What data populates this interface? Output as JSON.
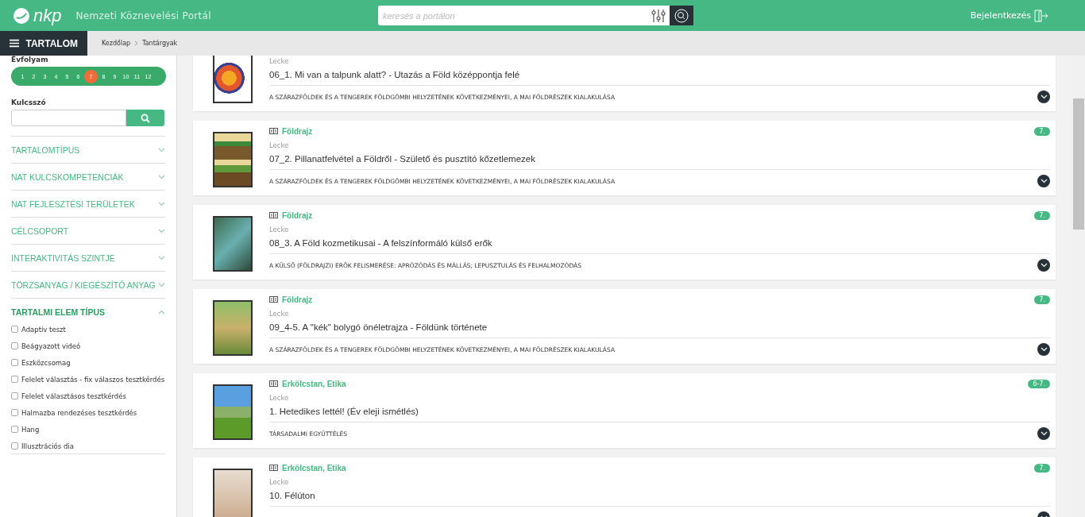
{
  "header": {
    "logo_text": "nkp",
    "portal_name": "Nemzeti Köznevelési Portál",
    "search": {
      "placeholder": "keresés a portálon"
    },
    "login": "Bejelentkezés"
  },
  "subbar": {
    "menu_button": "TARTALOM",
    "breadcrumbs": [
      {
        "label": "Kezdőlap"
      },
      {
        "label": "Tantárgyak"
      }
    ]
  },
  "sidebar": {
    "grade_label": "Évfolyam",
    "grades": [
      {
        "label": "1",
        "selected": false
      },
      {
        "label": "2",
        "selected": false
      },
      {
        "label": "3",
        "selected": false
      },
      {
        "label": "4",
        "selected": false
      },
      {
        "label": "5",
        "selected": false
      },
      {
        "label": "6",
        "selected": false
      },
      {
        "label": "7",
        "selected": true
      },
      {
        "label": "8",
        "selected": false
      },
      {
        "label": "9",
        "selected": false
      },
      {
        "label": "10",
        "selected": false
      },
      {
        "label": "11",
        "selected": false
      },
      {
        "label": "12",
        "selected": false
      }
    ],
    "keyword_label": "Kulcsszó",
    "filters": [
      {
        "label": "TARTALOMTÍPUS",
        "expanded": false
      },
      {
        "label": "NAT KULCSKOMPETENCIÁK",
        "expanded": false
      },
      {
        "label": "NAT FEJLESZTÉSI TERÜLETEK",
        "expanded": false
      },
      {
        "label": "CÉLCSOPORT",
        "expanded": false
      },
      {
        "label": "INTERAKTIVITÁS SZINTJE",
        "expanded": false
      },
      {
        "label": "TÖRZSANYAG / KIEGÉSZÍTŐ ANYAG",
        "expanded": false
      },
      {
        "label": "TARTALMI ELEM TÍPUS",
        "expanded": true,
        "options": [
          {
            "label": "Adaptív teszt",
            "checked": false
          },
          {
            "label": "Beágyazott videó",
            "checked": false
          },
          {
            "label": "Eszközcsomag",
            "checked": false
          },
          {
            "label": "Felelet választás - fix válaszos tesztkérdés",
            "checked": false
          },
          {
            "label": "Felelet választásos tesztkérdés",
            "checked": false
          },
          {
            "label": "Halmazba rendezéses tesztkérdés",
            "checked": false
          },
          {
            "label": "Hang",
            "checked": false
          },
          {
            "label": "Illusztrációs dia",
            "checked": false
          }
        ]
      }
    ]
  },
  "results": [
    {
      "type": "Lecke",
      "title": "06_1. Mi van a talpunk alatt? - Utazás a Föld középpontja felé",
      "topic": "A SZÁRAZFÖLDEK ÉS A TENGEREK FÖLDGÖMBI HELYZETÉNEK KÖVETKEZMÉNYEI, A MAI FÖLDRÉSZEK KIALAKULÁSA"
    },
    {
      "subject": "Földrajz",
      "grade": "7.",
      "type": "Lecke",
      "title": "07_2. Pillanatfelvétel a Földről - Születő és pusztító kőzetlemezek",
      "topic": "A SZÁRAZFÖLDEK ÉS A TENGEREK FÖLDGÖMBI HELYZETÉNEK KÖVETKEZMÉNYEI, A MAI FÖLDRÉSZEK KIALAKULÁSA"
    },
    {
      "subject": "Földrajz",
      "grade": "7.",
      "type": "Lecke",
      "title": "08_3. A Föld kozmetikusai - A felszínformáló külső erők",
      "topic": "A KÜLSŐ (FÖLDRAJZI) ERŐK FELISMERÉSE: APRÓZÓDÁS ÉS MÁLLÁS; LEPUSZTULÁS ÉS FELHALMOZÓDÁS"
    },
    {
      "subject": "Földrajz",
      "grade": "7.",
      "type": "Lecke",
      "title": "09_4-5. A \"kék\" bolygó önéletrajza - Földünk története",
      "topic": "A SZÁRAZFÖLDEK ÉS A TENGEREK FÖLDGÖMBI HELYZETÉNEK KÖVETKEZMÉNYEI, A MAI FÖLDRÉSZEK KIALAKULÁSA"
    },
    {
      "subject": "Erkölcstan, Etika",
      "grade": "6-7.",
      "type": "Lecke",
      "title": "1. Hetedikes lettél! (Év eleji ismétlés)",
      "topic": "TÁRSADALMI EGYÜTTÉLÉS"
    },
    {
      "subject": "Erkölcstan, Etika",
      "grade": "7.",
      "type": "Lecke",
      "title": "10. Félúton"
    }
  ]
}
